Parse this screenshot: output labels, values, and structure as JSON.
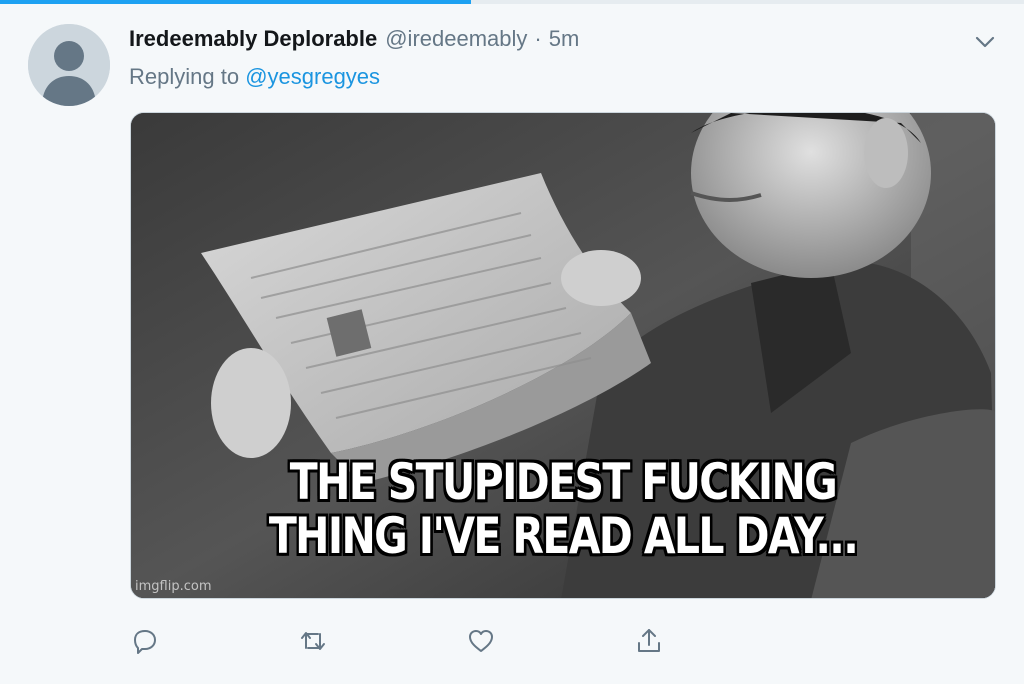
{
  "progress": {
    "fraction": 0.46,
    "color": "#1da1f2"
  },
  "tweet": {
    "display_name": "Iredeemably Deplorable",
    "handle": "@iredeemably",
    "separator": "·",
    "time": "5m",
    "replying_prefix": "Replying to",
    "replying_to": "@yesgregyes",
    "menu_icon": "chevron-down-icon"
  },
  "media": {
    "caption_line_1": "THE STUPIDEST FUCKING",
    "caption_line_2": "THING I'VE READ ALL DAY...",
    "watermark": "imgflip.com"
  },
  "actions": [
    {
      "name": "reply",
      "icon": "reply-icon"
    },
    {
      "name": "retweet",
      "icon": "retweet-icon"
    },
    {
      "name": "like",
      "icon": "heart-icon"
    },
    {
      "name": "share",
      "icon": "share-icon"
    }
  ],
  "colors": {
    "background": "#f5f8fa",
    "text_primary": "#14171a",
    "text_secondary": "#657786",
    "link": "#1b95e0"
  }
}
